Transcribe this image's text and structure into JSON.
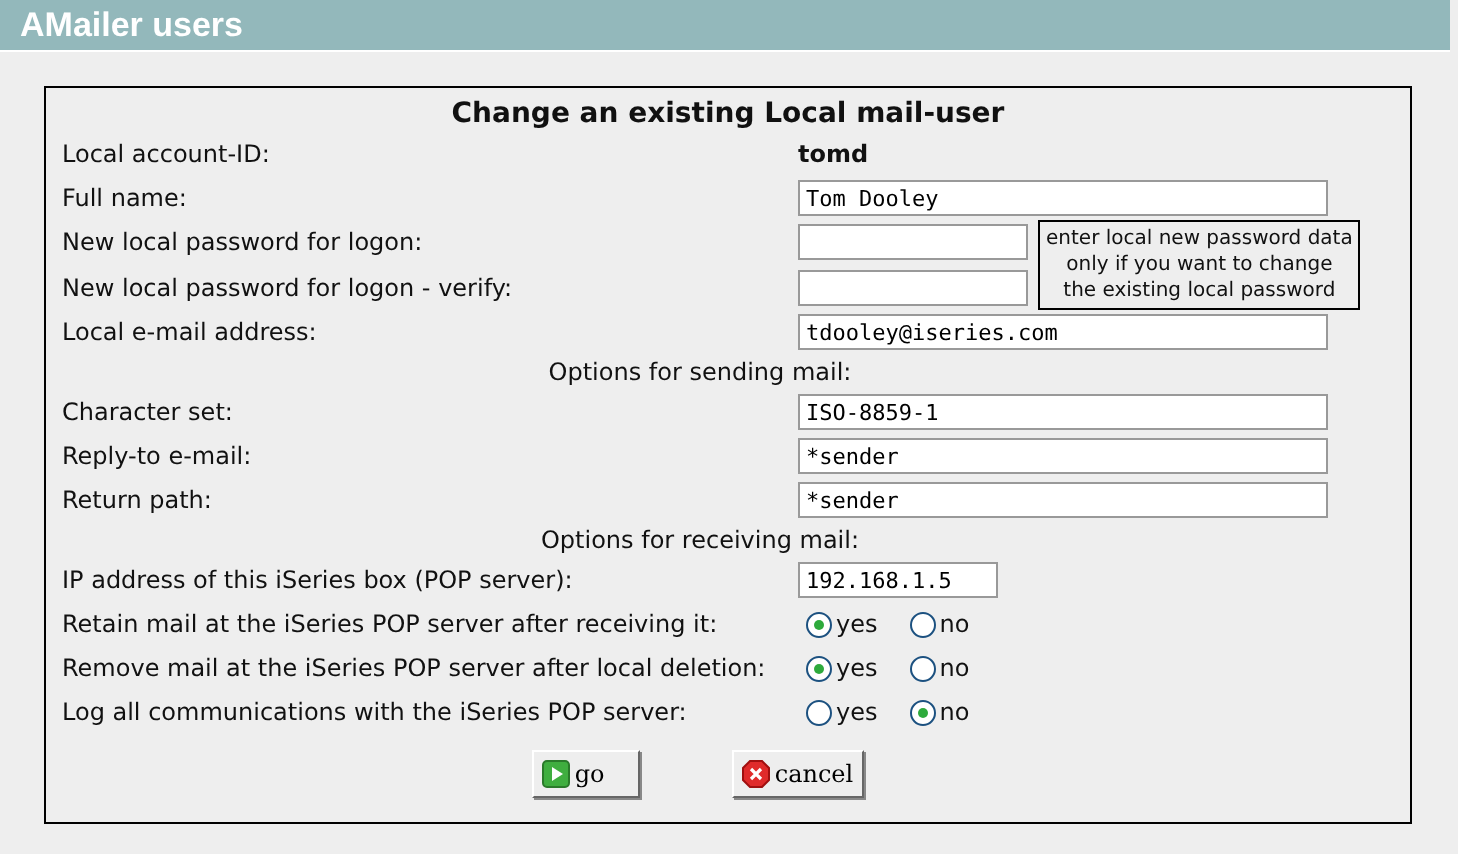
{
  "header": {
    "title": "AMailer users"
  },
  "form": {
    "title": "Change an existing Local mail-user",
    "password_note": "enter local new password data\nonly if you want to change\nthe existing local password",
    "rows": [
      {
        "kind": "static",
        "label": "Local account-ID:",
        "value": "tomd"
      },
      {
        "kind": "text",
        "label": "Full name:",
        "value": "Tom Dooley"
      },
      {
        "kind": "password",
        "label": "New local password for logon:"
      },
      {
        "kind": "password",
        "label": "New local password for logon - verify:"
      },
      {
        "kind": "text",
        "label": "Local e-mail address:",
        "value": "tdooley@iseries.com"
      },
      {
        "kind": "section",
        "label": "Options for sending mail:"
      },
      {
        "kind": "text",
        "label": "Character set:",
        "value": "ISO-8859-1"
      },
      {
        "kind": "text",
        "label": "Reply-to e-mail:",
        "value": "*sender"
      },
      {
        "kind": "text",
        "label": "Return path:",
        "value": "*sender"
      },
      {
        "kind": "section",
        "label": "Options for receiving mail:"
      },
      {
        "kind": "short",
        "label": "IP address of this iSeries box (POP server):",
        "value": "192.168.1.5"
      },
      {
        "kind": "radio",
        "label": "Retain mail at the iSeries POP server after receiving it:",
        "options": [
          {
            "label": "yes",
            "selected": true
          },
          {
            "label": "no",
            "selected": false
          }
        ]
      },
      {
        "kind": "radio",
        "label": "Remove mail at the iSeries POP server after local deletion:",
        "options": [
          {
            "label": "yes",
            "selected": true
          },
          {
            "label": "no",
            "selected": false
          }
        ]
      },
      {
        "kind": "radio",
        "label": "Log all communications with the iSeries POP server:",
        "options": [
          {
            "label": "yes",
            "selected": false
          },
          {
            "label": "no",
            "selected": true
          }
        ]
      }
    ],
    "buttons": [
      {
        "kind": "go",
        "label": "go"
      },
      {
        "kind": "cancel",
        "label": "cancel"
      }
    ]
  }
}
